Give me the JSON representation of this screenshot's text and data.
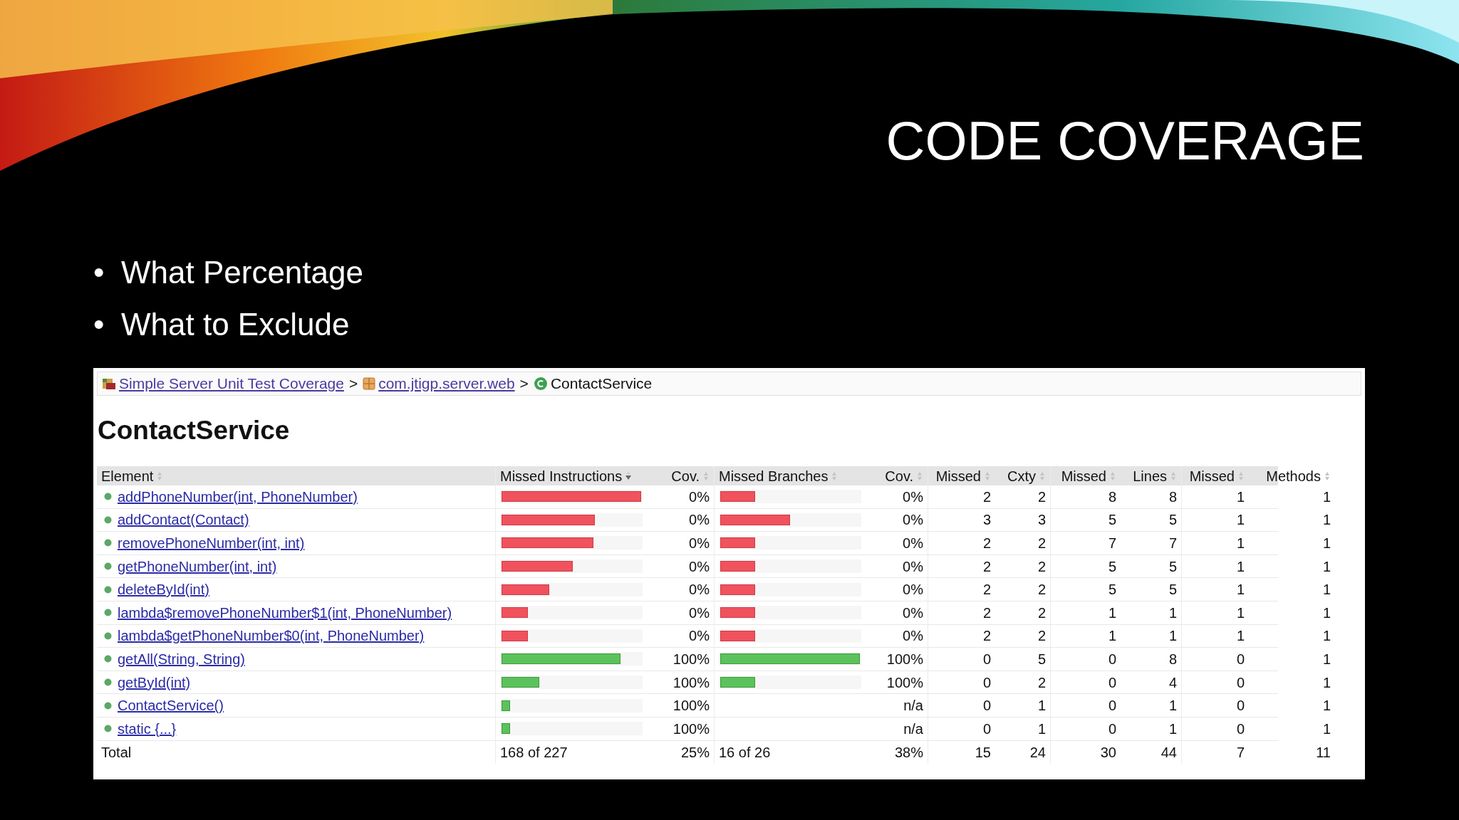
{
  "slide": {
    "title": "CODE COVERAGE",
    "bullets": [
      {
        "bullet": "•",
        "text": "What Percentage"
      },
      {
        "bullet": "•",
        "text": "What to Exclude"
      }
    ]
  },
  "report": {
    "breadcrumbs": [
      {
        "label": "Simple Server Unit Test Coverage",
        "kind": "report",
        "link": true,
        "separator": ">"
      },
      {
        "label": "com.jtigp.server.web",
        "kind": "package",
        "link": true,
        "separator": ">"
      },
      {
        "label": "ContactService",
        "kind": "class",
        "link": false
      }
    ],
    "heading": "ContactService",
    "columns": [
      {
        "label": "Element",
        "sorted": false
      },
      {
        "label": "Missed Instructions",
        "sorted": true
      },
      {
        "label": "Cov.",
        "sorted": false
      },
      {
        "label": "Missed Branches",
        "sorted": false
      },
      {
        "label": "Cov.",
        "sorted": false
      },
      {
        "label": "Missed",
        "sorted": false
      },
      {
        "label": "Cxty",
        "sorted": false
      },
      {
        "label": "Missed",
        "sorted": false
      },
      {
        "label": "Lines",
        "sorted": false
      },
      {
        "label": "Missed",
        "sorted": false
      },
      {
        "label": "Methods",
        "sorted": false
      }
    ],
    "rows": [
      {
        "name": "addPhoneNumber(int, PhoneNumber)",
        "instr_bar": {
          "level": 1,
          "covered": false
        },
        "instr_cov": "0%",
        "branch_bar": {
          "level": 0.25,
          "covered": false
        },
        "branch_cov": "0%",
        "missed_cxty": "2",
        "cxty": "2",
        "missed_lines": "8",
        "lines": "8",
        "missed_methods": "1",
        "methods": "1"
      },
      {
        "name": "addContact(Contact)",
        "instr_bar": {
          "level": 0.67,
          "covered": false
        },
        "instr_cov": "0%",
        "branch_bar": {
          "level": 0.5,
          "covered": false
        },
        "branch_cov": "0%",
        "missed_cxty": "3",
        "cxty": "3",
        "missed_lines": "5",
        "lines": "5",
        "missed_methods": "1",
        "methods": "1"
      },
      {
        "name": "removePhoneNumber(int, int)",
        "instr_bar": {
          "level": 0.66,
          "covered": false
        },
        "instr_cov": "0%",
        "branch_bar": {
          "level": 0.25,
          "covered": false
        },
        "branch_cov": "0%",
        "missed_cxty": "2",
        "cxty": "2",
        "missed_lines": "7",
        "lines": "7",
        "missed_methods": "1",
        "methods": "1"
      },
      {
        "name": "getPhoneNumber(int, int)",
        "instr_bar": {
          "level": 0.51,
          "covered": false
        },
        "instr_cov": "0%",
        "branch_bar": {
          "level": 0.25,
          "covered": false
        },
        "branch_cov": "0%",
        "missed_cxty": "2",
        "cxty": "2",
        "missed_lines": "5",
        "lines": "5",
        "missed_methods": "1",
        "methods": "1"
      },
      {
        "name": "deleteById(int)",
        "instr_bar": {
          "level": 0.34,
          "covered": false
        },
        "instr_cov": "0%",
        "branch_bar": {
          "level": 0.25,
          "covered": false
        },
        "branch_cov": "0%",
        "missed_cxty": "2",
        "cxty": "2",
        "missed_lines": "5",
        "lines": "5",
        "missed_methods": "1",
        "methods": "1"
      },
      {
        "name": "lambda$removePhoneNumber$1(int, PhoneNumber)",
        "instr_bar": {
          "level": 0.19,
          "covered": false
        },
        "instr_cov": "0%",
        "branch_bar": {
          "level": 0.25,
          "covered": false
        },
        "branch_cov": "0%",
        "missed_cxty": "2",
        "cxty": "2",
        "missed_lines": "1",
        "lines": "1",
        "missed_methods": "1",
        "methods": "1"
      },
      {
        "name": "lambda$getPhoneNumber$0(int, PhoneNumber)",
        "instr_bar": {
          "level": 0.19,
          "covered": false
        },
        "instr_cov": "0%",
        "branch_bar": {
          "level": 0.25,
          "covered": false
        },
        "branch_cov": "0%",
        "missed_cxty": "2",
        "cxty": "2",
        "missed_lines": "1",
        "lines": "1",
        "missed_methods": "1",
        "methods": "1"
      },
      {
        "name": "getAll(String, String)",
        "instr_bar": {
          "level": 0.85,
          "covered": true
        },
        "instr_cov": "100%",
        "branch_bar": {
          "level": 1,
          "covered": true
        },
        "branch_cov": "100%",
        "missed_cxty": "0",
        "cxty": "5",
        "missed_lines": "0",
        "lines": "8",
        "missed_methods": "0",
        "methods": "1"
      },
      {
        "name": "getById(int)",
        "instr_bar": {
          "level": 0.27,
          "covered": true
        },
        "instr_cov": "100%",
        "branch_bar": {
          "level": 0.25,
          "covered": true
        },
        "branch_cov": "100%",
        "missed_cxty": "0",
        "cxty": "2",
        "missed_lines": "0",
        "lines": "4",
        "missed_methods": "0",
        "methods": "1"
      },
      {
        "name": "ContactService()",
        "instr_bar": {
          "level": 0.06,
          "covered": true
        },
        "instr_cov": "100%",
        "branch_cov": "n/a",
        "missed_cxty": "0",
        "cxty": "1",
        "missed_lines": "0",
        "lines": "1",
        "missed_methods": "0",
        "methods": "1"
      },
      {
        "name": "static {...}",
        "instr_bar": {
          "level": 0.06,
          "covered": true
        },
        "instr_cov": "100%",
        "branch_cov": "n/a",
        "missed_cxty": "0",
        "cxty": "1",
        "missed_lines": "0",
        "lines": "1",
        "missed_methods": "0",
        "methods": "1"
      }
    ],
    "total": {
      "label": "Total",
      "missed_instructions": "168 of 227",
      "instr_cov": "25%",
      "missed_branches": "16 of 26",
      "branch_cov": "38%",
      "missed_cxty": "15",
      "cxty": "24",
      "missed_lines": "30",
      "lines": "44",
      "missed_methods": "7",
      "methods": "11"
    }
  }
}
